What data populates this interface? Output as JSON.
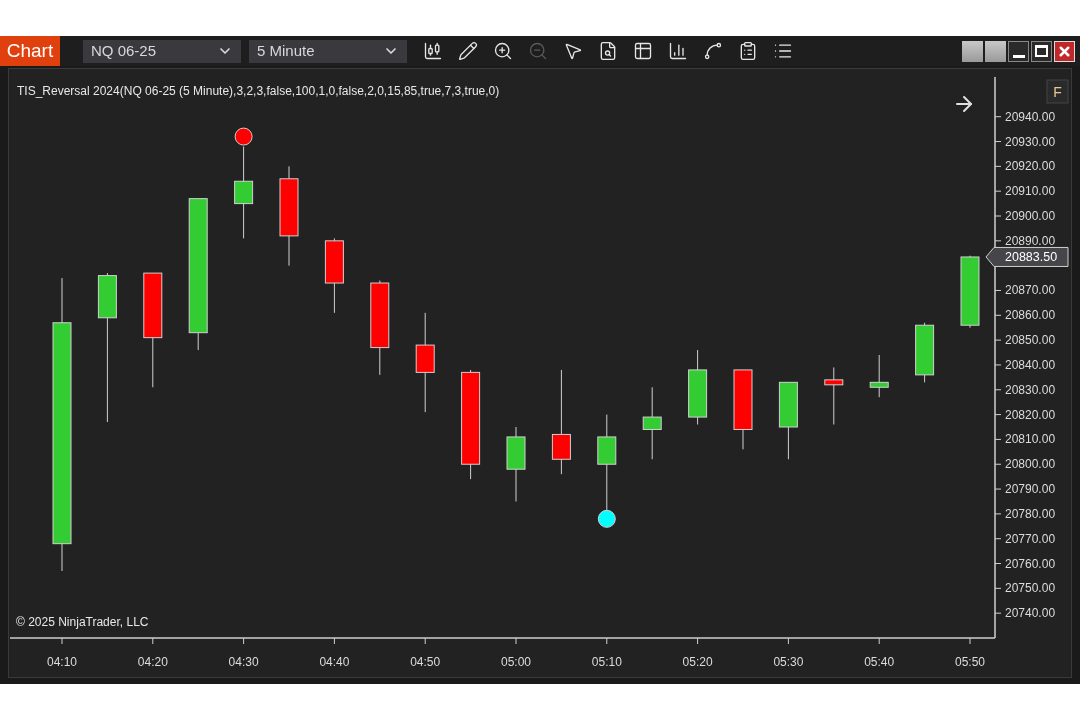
{
  "toolbar": {
    "app_label": "Chart",
    "instrument": {
      "value": "NQ 06-25"
    },
    "interval": {
      "value": "5 Minute"
    },
    "tools": [
      {
        "kind": "candlestick",
        "disabled": false
      },
      {
        "kind": "pencil",
        "disabled": false
      },
      {
        "kind": "zoom-in",
        "disabled": false
      },
      {
        "kind": "zoom-out",
        "disabled": true
      },
      {
        "kind": "pointer",
        "disabled": false
      },
      {
        "kind": "data-box",
        "disabled": false
      },
      {
        "kind": "templates",
        "disabled": false
      },
      {
        "kind": "bars",
        "disabled": false
      },
      {
        "kind": "strategies",
        "disabled": false
      },
      {
        "kind": "properties",
        "disabled": false
      },
      {
        "kind": "list",
        "disabled": false
      }
    ]
  },
  "chart": {
    "indicator_label": "TIS_Reversal 2024(NQ 06-25 (5 Minute),3,2,3,false,100,1,0,false,2,0,15,85,true,7,3,true,0)",
    "panel_button": "F",
    "copyright": "© 2025 NinjaTrader, LLC",
    "last_price_label": "20883.50",
    "price_axis_labels": [
      "20940.00",
      "20930.00",
      "20920.00",
      "20910.00",
      "20900.00",
      "20890.00",
      "20870.00",
      "20860.00",
      "20850.00",
      "20840.00",
      "20830.00",
      "20820.00",
      "20810.00",
      "20800.00",
      "20790.00",
      "20780.00",
      "20770.00",
      "20760.00",
      "20750.00",
      "20740.00"
    ],
    "time_axis_labels": [
      "04:10",
      "04:20",
      "04:30",
      "04:40",
      "04:50",
      "05:00",
      "05:10",
      "05:20",
      "05:30",
      "05:40",
      "05:50"
    ]
  }
}
